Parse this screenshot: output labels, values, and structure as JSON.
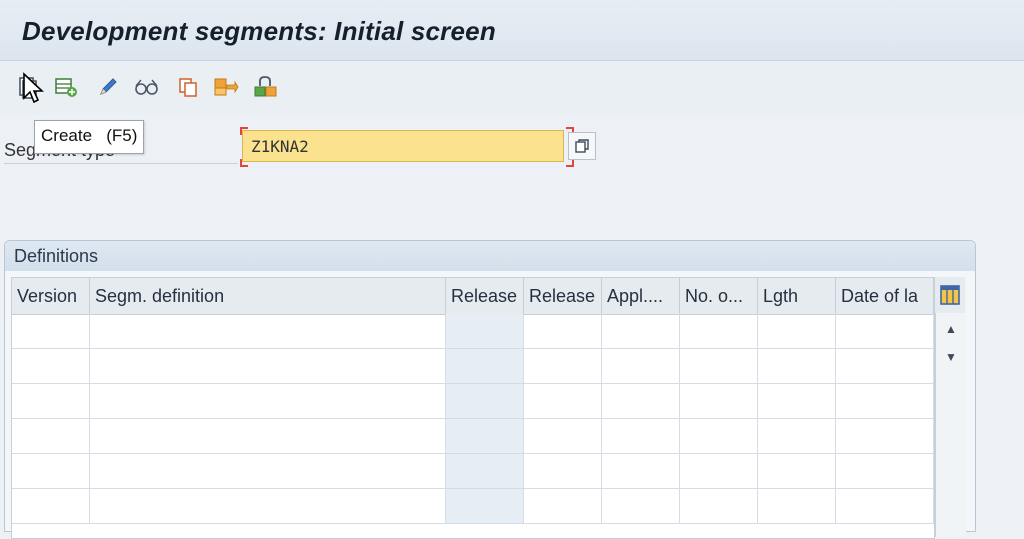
{
  "window": {
    "title": "Development segments: Initial screen"
  },
  "toolbar": {
    "buttons": [
      {
        "icon": "create-icon"
      },
      {
        "icon": "add-segment-icon"
      },
      {
        "icon": "edit-pencil-icon"
      },
      {
        "icon": "display-glasses-icon"
      },
      {
        "icon": "copy-icon"
      },
      {
        "icon": "transport-icon"
      },
      {
        "icon": "release-icon"
      }
    ],
    "tooltip": "Create   (F5)"
  },
  "form": {
    "segment_type_label": "Segment type",
    "segment_type_value": "Z1KNA2"
  },
  "definitions": {
    "title": "Definitions",
    "columns": [
      "Version",
      "Segm. definition",
      "Release",
      "Release",
      "Appl....",
      "No. o...",
      "Lgth",
      "Date of la"
    ],
    "rows": [
      [
        "",
        "",
        "",
        "",
        "",
        "",
        "",
        ""
      ],
      [
        "",
        "",
        "",
        "",
        "",
        "",
        "",
        ""
      ],
      [
        "",
        "",
        "",
        "",
        "",
        "",
        "",
        ""
      ],
      [
        "",
        "",
        "",
        "",
        "",
        "",
        "",
        ""
      ],
      [
        "",
        "",
        "",
        "",
        "",
        "",
        "",
        ""
      ],
      [
        "",
        "",
        "",
        "",
        "",
        "",
        "",
        ""
      ]
    ]
  },
  "colors": {
    "required_input": "#fbe28f",
    "required_marker": "#e2453a",
    "title_bar": "#e7edf4"
  }
}
